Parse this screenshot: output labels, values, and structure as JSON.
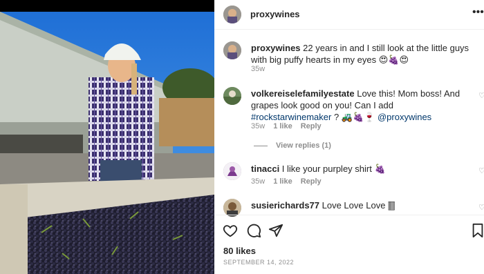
{
  "post": {
    "username": "proxywines",
    "caption_user": "proxywines",
    "caption_text": " 22 years in and I still look at the little guys with big puffy hearts in my eyes 😍🍇😍",
    "caption_age": "35w"
  },
  "comments": [
    {
      "user": "volkereiselefamilyestate",
      "text": " Love this! Mom boss! And grapes look good on you! Can I add ",
      "hashtag": "#rockstarwinemaker",
      "text2": " ? 🚜🍇🍷 ",
      "mention": "@proxywines",
      "age": "35w",
      "likes": "1 like",
      "reply": "Reply"
    },
    {
      "user": "tinacci",
      "text": " I like your purpley shirt 🍇",
      "age": "35w",
      "likes": "1 like",
      "reply": "Reply"
    },
    {
      "user": "susierichards77",
      "text": " Love Love Love 🀫"
    }
  ],
  "view_replies": "View replies (1)",
  "icons": {
    "more": "more-options-icon",
    "like": "heart-icon",
    "comment": "comment-icon",
    "share": "share-icon",
    "save": "bookmark-icon"
  },
  "likes": "80 likes",
  "date": "SEPTEMBER 14, 2022"
}
